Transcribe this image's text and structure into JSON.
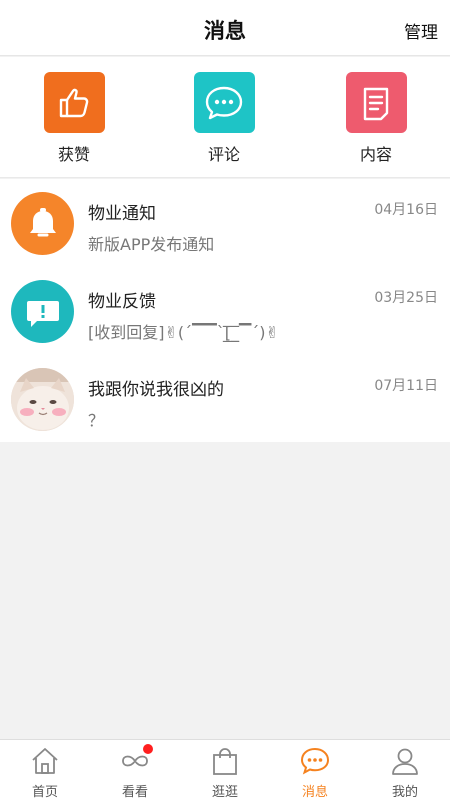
{
  "header": {
    "title": "消息",
    "manage_label": "管理"
  },
  "quick_actions": [
    {
      "label": "获赞",
      "icon": "thumbs-up-icon",
      "color": "#f06e1e"
    },
    {
      "label": "评论",
      "icon": "comment-bubble-icon",
      "color": "#1ec4c6"
    },
    {
      "label": "内容",
      "icon": "document-icon",
      "color": "#ee5b6e"
    }
  ],
  "messages": [
    {
      "name": "物业通知",
      "preview": "新版APP发布通知",
      "date": "04月16日",
      "avatar_icon": "bell-icon",
      "avatar_color": "#f5852a"
    },
    {
      "name": "物业反馈",
      "preview": "[收到回复]✌(ˊ▔▔ˋ[̲̅_̲̅▔ˊ)✌",
      "date": "03月25日",
      "avatar_icon": "feedback-icon",
      "avatar_color": "#1eb8bd"
    },
    {
      "name": "我跟你说我很凶的",
      "preview": "？",
      "date": "07月11日",
      "avatar_icon": "cat-photo-avatar",
      "avatar_color": "#e8d9cf"
    }
  ],
  "tabs": [
    {
      "label": "首页",
      "icon": "home-icon",
      "active": false
    },
    {
      "label": "看看",
      "icon": "infinity-icon",
      "active": false,
      "badge": true
    },
    {
      "label": "逛逛",
      "icon": "shopping-bag-icon",
      "active": false
    },
    {
      "label": "消息",
      "icon": "message-bubble-icon",
      "active": true
    },
    {
      "label": "我的",
      "icon": "person-icon",
      "active": false
    }
  ],
  "colors": {
    "accent": "#f5821f",
    "badge": "#ff1f1f"
  }
}
